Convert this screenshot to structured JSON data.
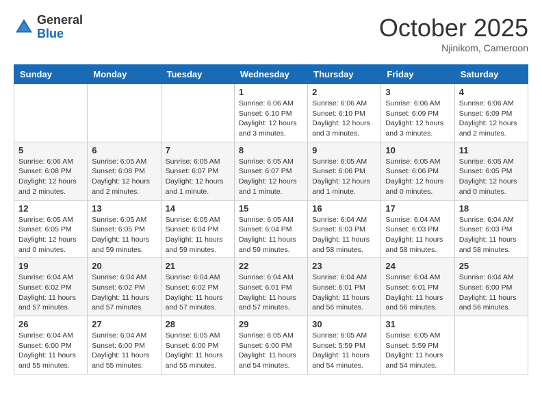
{
  "header": {
    "logo_general": "General",
    "logo_blue": "Blue",
    "month_title": "October 2025",
    "location": "Njinikom, Cameroon"
  },
  "weekdays": [
    "Sunday",
    "Monday",
    "Tuesday",
    "Wednesday",
    "Thursday",
    "Friday",
    "Saturday"
  ],
  "weeks": [
    [
      {
        "day": "",
        "info": ""
      },
      {
        "day": "",
        "info": ""
      },
      {
        "day": "",
        "info": ""
      },
      {
        "day": "1",
        "info": "Sunrise: 6:06 AM\nSunset: 6:10 PM\nDaylight: 12 hours\nand 3 minutes."
      },
      {
        "day": "2",
        "info": "Sunrise: 6:06 AM\nSunset: 6:10 PM\nDaylight: 12 hours\nand 3 minutes."
      },
      {
        "day": "3",
        "info": "Sunrise: 6:06 AM\nSunset: 6:09 PM\nDaylight: 12 hours\nand 3 minutes."
      },
      {
        "day": "4",
        "info": "Sunrise: 6:06 AM\nSunset: 6:09 PM\nDaylight: 12 hours\nand 2 minutes."
      }
    ],
    [
      {
        "day": "5",
        "info": "Sunrise: 6:06 AM\nSunset: 6:08 PM\nDaylight: 12 hours\nand 2 minutes."
      },
      {
        "day": "6",
        "info": "Sunrise: 6:05 AM\nSunset: 6:08 PM\nDaylight: 12 hours\nand 2 minutes."
      },
      {
        "day": "7",
        "info": "Sunrise: 6:05 AM\nSunset: 6:07 PM\nDaylight: 12 hours\nand 1 minute."
      },
      {
        "day": "8",
        "info": "Sunrise: 6:05 AM\nSunset: 6:07 PM\nDaylight: 12 hours\nand 1 minute."
      },
      {
        "day": "9",
        "info": "Sunrise: 6:05 AM\nSunset: 6:06 PM\nDaylight: 12 hours\nand 1 minute."
      },
      {
        "day": "10",
        "info": "Sunrise: 6:05 AM\nSunset: 6:06 PM\nDaylight: 12 hours\nand 0 minutes."
      },
      {
        "day": "11",
        "info": "Sunrise: 6:05 AM\nSunset: 6:05 PM\nDaylight: 12 hours\nand 0 minutes."
      }
    ],
    [
      {
        "day": "12",
        "info": "Sunrise: 6:05 AM\nSunset: 6:05 PM\nDaylight: 12 hours\nand 0 minutes."
      },
      {
        "day": "13",
        "info": "Sunrise: 6:05 AM\nSunset: 6:05 PM\nDaylight: 11 hours\nand 59 minutes."
      },
      {
        "day": "14",
        "info": "Sunrise: 6:05 AM\nSunset: 6:04 PM\nDaylight: 11 hours\nand 59 minutes."
      },
      {
        "day": "15",
        "info": "Sunrise: 6:05 AM\nSunset: 6:04 PM\nDaylight: 11 hours\nand 59 minutes."
      },
      {
        "day": "16",
        "info": "Sunrise: 6:04 AM\nSunset: 6:03 PM\nDaylight: 11 hours\nand 58 minutes."
      },
      {
        "day": "17",
        "info": "Sunrise: 6:04 AM\nSunset: 6:03 PM\nDaylight: 11 hours\nand 58 minutes."
      },
      {
        "day": "18",
        "info": "Sunrise: 6:04 AM\nSunset: 6:03 PM\nDaylight: 11 hours\nand 58 minutes."
      }
    ],
    [
      {
        "day": "19",
        "info": "Sunrise: 6:04 AM\nSunset: 6:02 PM\nDaylight: 11 hours\nand 57 minutes."
      },
      {
        "day": "20",
        "info": "Sunrise: 6:04 AM\nSunset: 6:02 PM\nDaylight: 11 hours\nand 57 minutes."
      },
      {
        "day": "21",
        "info": "Sunrise: 6:04 AM\nSunset: 6:02 PM\nDaylight: 11 hours\nand 57 minutes."
      },
      {
        "day": "22",
        "info": "Sunrise: 6:04 AM\nSunset: 6:01 PM\nDaylight: 11 hours\nand 57 minutes."
      },
      {
        "day": "23",
        "info": "Sunrise: 6:04 AM\nSunset: 6:01 PM\nDaylight: 11 hours\nand 56 minutes."
      },
      {
        "day": "24",
        "info": "Sunrise: 6:04 AM\nSunset: 6:01 PM\nDaylight: 11 hours\nand 56 minutes."
      },
      {
        "day": "25",
        "info": "Sunrise: 6:04 AM\nSunset: 6:00 PM\nDaylight: 11 hours\nand 56 minutes."
      }
    ],
    [
      {
        "day": "26",
        "info": "Sunrise: 6:04 AM\nSunset: 6:00 PM\nDaylight: 11 hours\nand 55 minutes."
      },
      {
        "day": "27",
        "info": "Sunrise: 6:04 AM\nSunset: 6:00 PM\nDaylight: 11 hours\nand 55 minutes."
      },
      {
        "day": "28",
        "info": "Sunrise: 6:05 AM\nSunset: 6:00 PM\nDaylight: 11 hours\nand 55 minutes."
      },
      {
        "day": "29",
        "info": "Sunrise: 6:05 AM\nSunset: 6:00 PM\nDaylight: 11 hours\nand 54 minutes."
      },
      {
        "day": "30",
        "info": "Sunrise: 6:05 AM\nSunset: 5:59 PM\nDaylight: 11 hours\nand 54 minutes."
      },
      {
        "day": "31",
        "info": "Sunrise: 6:05 AM\nSunset: 5:59 PM\nDaylight: 11 hours\nand 54 minutes."
      },
      {
        "day": "",
        "info": ""
      }
    ]
  ]
}
